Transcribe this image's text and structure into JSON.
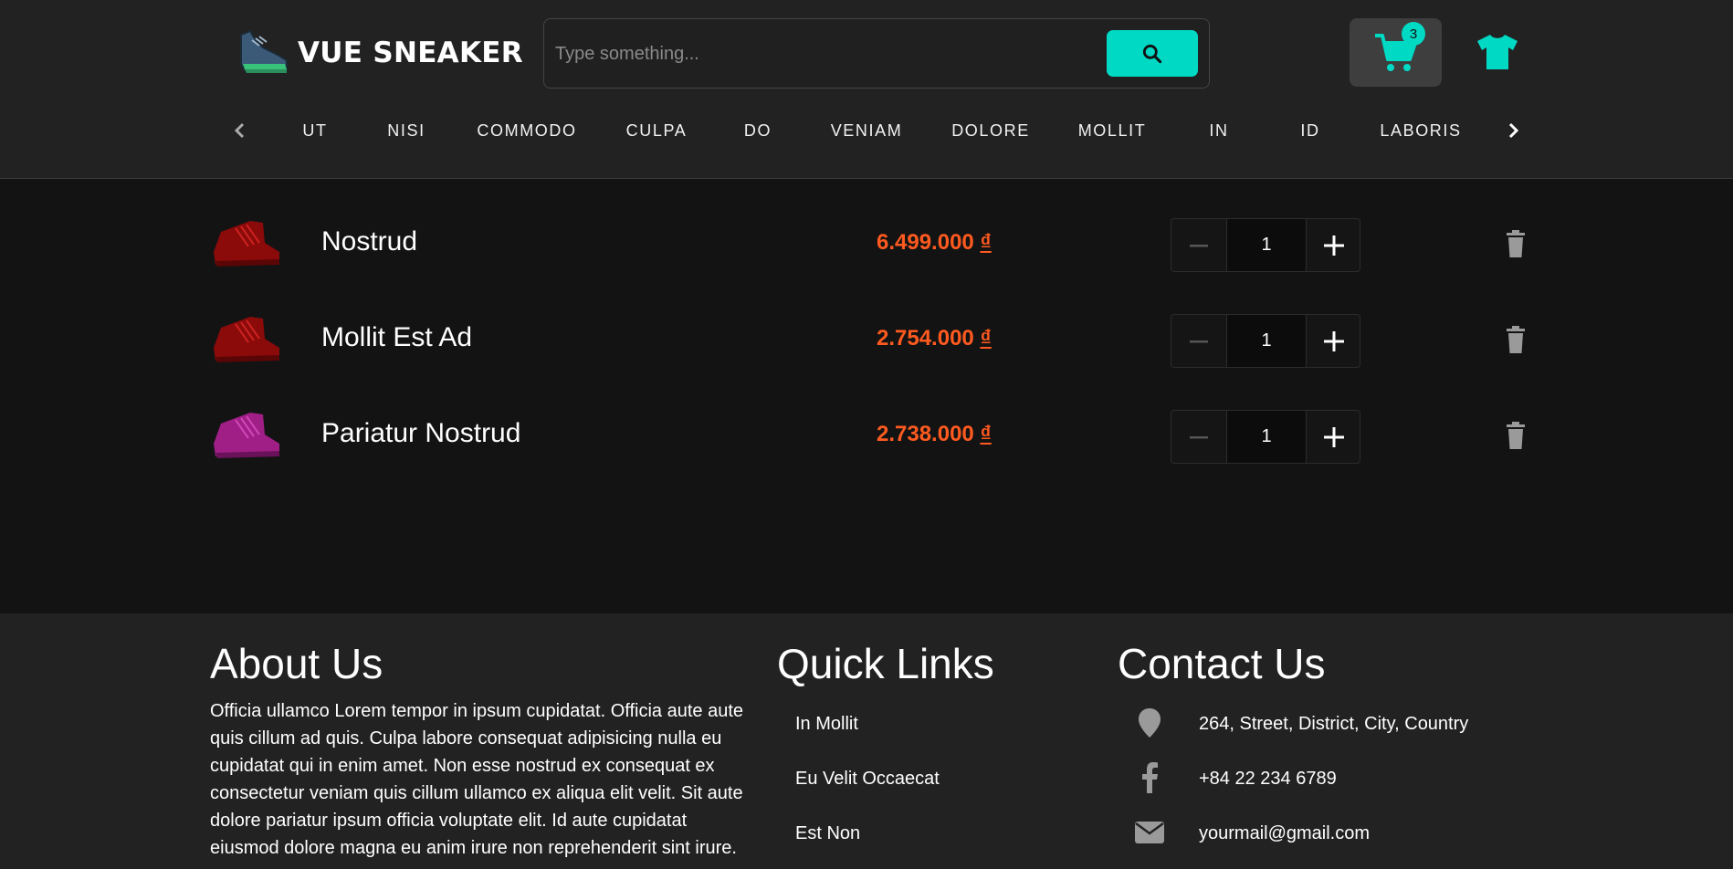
{
  "brand": {
    "name": "VUE SNEAKER"
  },
  "search": {
    "placeholder": "Type something..."
  },
  "cart": {
    "count": "3"
  },
  "categories": [
    "UT",
    "NISI",
    "COMMODO",
    "CULPA",
    "DO",
    "VENIAM",
    "DOLORE",
    "MOLLIT",
    "IN",
    "ID",
    "LABORIS"
  ],
  "cart_items": [
    {
      "name": "Nostrud",
      "price": "6.499.000",
      "currency": "₫",
      "quantity": "1",
      "shoe_color": "#8b0a0a"
    },
    {
      "name": "Mollit Est Ad",
      "price": "2.754.000",
      "currency": "₫",
      "quantity": "1",
      "shoe_color": "#8b0a0a"
    },
    {
      "name": "Pariatur Nostrud",
      "price": "2.738.000",
      "currency": "₫",
      "quantity": "1",
      "shoe_color": "#a01f86"
    }
  ],
  "footer": {
    "about": {
      "title": "About Us",
      "text": "Officia ullamco Lorem tempor in ipsum cupidatat. Officia aute aute quis cillum ad quis. Culpa labore consequat adipisicing nulla eu cupidatat qui in enim amet. Non esse nostrud ex consequat ex consectetur veniam quis cillum ullamco ex aliqua elit velit. Sit aute dolore pariatur ipsum officia voluptate elit. Id aute cupidatat eiusmod dolore magna eu anim irure non reprehenderit sint irure."
    },
    "quick_links": {
      "title": "Quick Links",
      "items": [
        "In Mollit",
        "Eu Velit Occaecat",
        "Est Non"
      ]
    },
    "contact": {
      "title": "Contact Us",
      "address": "264, Street, District, City, Country",
      "phone": "+84 22 234 6789",
      "email": "yourmail@gmail.com"
    }
  },
  "colors": {
    "accent": "#00d9c4",
    "price": "#ff5a1f",
    "header_bg": "#222222",
    "body_bg": "#131313"
  }
}
